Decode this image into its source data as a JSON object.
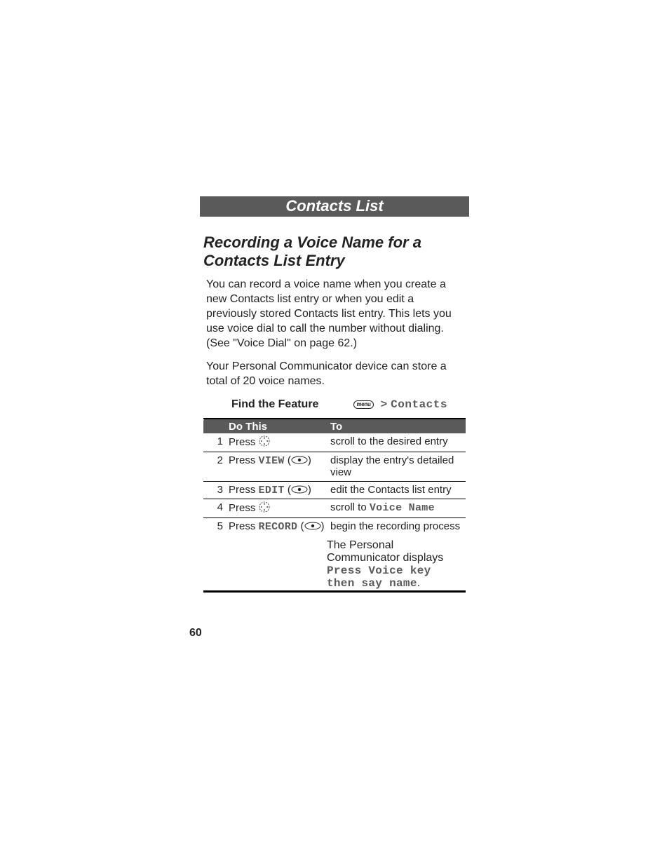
{
  "section_title": "Contacts List",
  "heading": "Recording a Voice Name for a Contacts List Entry",
  "para1": "You can record a voice name when you create a new Contacts list entry or when you edit a previously stored Contacts list entry. This lets you use voice dial to call the number without dialing. (See \"Voice Dial\" on page 62.)",
  "para2": "Your Personal Communicator device can store a total of 20 voice names.",
  "feature": {
    "label": "Find the Feature",
    "menu_label": "menu",
    "path_gt": ">",
    "path_item": "Contacts"
  },
  "table": {
    "head_do": "Do This",
    "head_to": "To",
    "rows": [
      {
        "n": "1",
        "press": "Press ",
        "btn": "",
        "icon": "scroll",
        "par": "",
        "to_pre": "scroll to the desired entry",
        "mono_in_to": "",
        "to_post": ""
      },
      {
        "n": "2",
        "press": "Press ",
        "btn": "VIEW",
        "icon": "softkey",
        "par": "yes",
        "to_pre": "display the entry's detailed view",
        "mono_in_to": "",
        "to_post": ""
      },
      {
        "n": "3",
        "press": "Press ",
        "btn": "EDIT",
        "icon": "softkey",
        "par": "yes",
        "to_pre": "edit the Contacts list entry",
        "mono_in_to": "",
        "to_post": ""
      },
      {
        "n": "4",
        "press": "Press ",
        "btn": "",
        "icon": "scroll",
        "par": "",
        "to_pre": "scroll to ",
        "mono_in_to": "Voice Name",
        "to_post": ""
      },
      {
        "n": "5",
        "press": "Press ",
        "btn": "RECORD",
        "icon": "softkey",
        "par": "yes",
        "to_pre": "begin the recording process",
        "mono_in_to": "",
        "to_post": ""
      }
    ],
    "extra": {
      "pre": "The Personal Communicator displays ",
      "mono": "Press Voice key then say name",
      "post": "."
    }
  },
  "page_number": "60"
}
